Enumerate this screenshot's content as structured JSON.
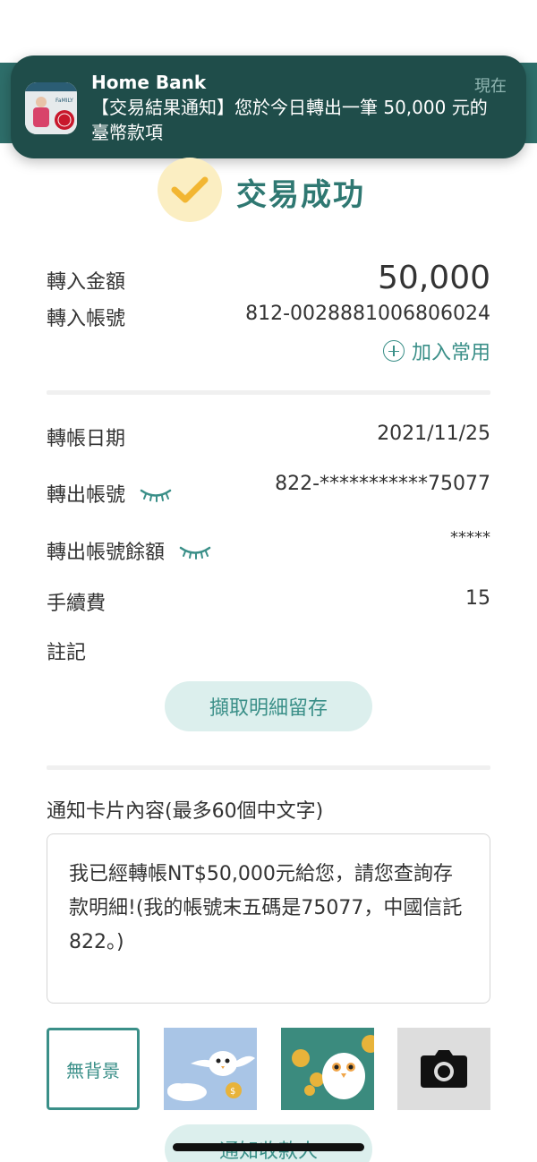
{
  "notification": {
    "app_name": "Home Bank",
    "time": "現在",
    "message": "【交易結果通知】您於今日轉出一筆 50,000 元的臺幣款項",
    "app_icon": "family-app-icon"
  },
  "status": {
    "title": "交易成功",
    "icon": "check-icon"
  },
  "transfer": {
    "amount_label": "轉入金額",
    "amount": "50,000",
    "account_label": "轉入帳號",
    "account": "812-0028881006806024",
    "add_favorite_label": "加入常用"
  },
  "details": {
    "date_label": "轉帳日期",
    "date": "2021/11/25",
    "from_account_label": "轉出帳號",
    "from_account": "822-***********75077",
    "balance_label": "轉出帳號餘額",
    "balance": "*****",
    "fee_label": "手續費",
    "fee": "15",
    "note_label": "註記"
  },
  "actions": {
    "screenshot_label": "擷取明細留存",
    "notify_label": "通知收款人"
  },
  "card": {
    "heading": "通知卡片內容(最多60個中文字)",
    "message": "我已經轉帳NT$50,000元給您，請您查詢存款明細!(我的帳號末五碼是75077，中國信託822。)"
  },
  "backgrounds": {
    "none_label": "無背景"
  },
  "colors": {
    "accent": "#3a8f88",
    "header": "#2e6e6a",
    "notification_bg": "#1f4d4a",
    "success_badge": "#fbeec2",
    "check": "#f2b632"
  }
}
